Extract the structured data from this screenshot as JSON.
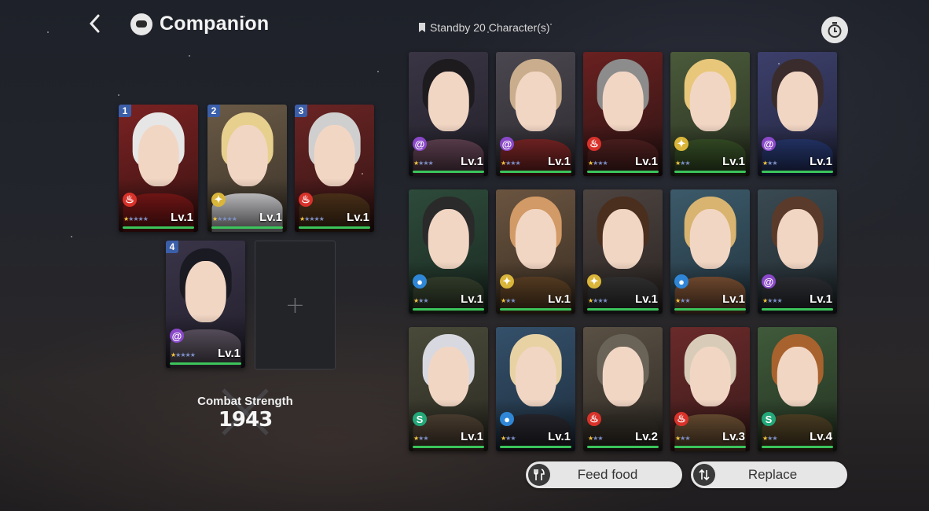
{
  "header": {
    "title": "Companion",
    "standby_label": "Standby 20 Character(s)"
  },
  "colors": {
    "star_on": "#f3c640",
    "star_off": "#7d90c7",
    "level_bar": "#3bc45b",
    "element": {
      "fire": "#d9322a",
      "light": "#d9b53a",
      "arcane": "#8a48c9",
      "water": "#2f86d6",
      "wind": "#23a879"
    }
  },
  "team": [
    {
      "slot": "1",
      "level": "Lv.1",
      "element": "fire",
      "stars": 1,
      "max_stars": 5
    },
    {
      "slot": "2",
      "level": "Lv.1",
      "element": "light",
      "stars": 1,
      "max_stars": 5
    },
    {
      "slot": "3",
      "level": "Lv.1",
      "element": "fire",
      "stars": 1,
      "max_stars": 5
    },
    {
      "slot": "4",
      "level": "Lv.1",
      "element": "arcane",
      "stars": 1,
      "max_stars": 5
    }
  ],
  "empty_slot_icon": "+",
  "combat": {
    "label": "Combat Strength",
    "value": "1943"
  },
  "standby": [
    {
      "level": "Lv.1",
      "element": "arcane",
      "stars": 1,
      "max_stars": 4
    },
    {
      "level": "Lv.1",
      "element": "arcane",
      "stars": 1,
      "max_stars": 4
    },
    {
      "level": "Lv.1",
      "element": "fire",
      "stars": 1,
      "max_stars": 4
    },
    {
      "level": "Lv.1",
      "element": "light",
      "stars": 1,
      "max_stars": 3
    },
    {
      "level": "Lv.1",
      "element": "arcane",
      "stars": 1,
      "max_stars": 3
    },
    {
      "level": "Lv.1",
      "element": "water",
      "stars": 1,
      "max_stars": 3
    },
    {
      "level": "Lv.1",
      "element": "light",
      "stars": 1,
      "max_stars": 3
    },
    {
      "level": "Lv.1",
      "element": "light",
      "stars": 1,
      "max_stars": 4
    },
    {
      "level": "Lv.1",
      "element": "water",
      "stars": 1,
      "max_stars": 3
    },
    {
      "level": "Lv.1",
      "element": "arcane",
      "stars": 1,
      "max_stars": 4
    },
    {
      "level": "Lv.1",
      "element": "wind",
      "stars": 1,
      "max_stars": 3
    },
    {
      "level": "Lv.1",
      "element": "water",
      "stars": 1,
      "max_stars": 3
    },
    {
      "level": "Lv.2",
      "element": "fire",
      "stars": 1,
      "max_stars": 3
    },
    {
      "level": "Lv.3",
      "element": "fire",
      "stars": 1,
      "max_stars": 3
    },
    {
      "level": "Lv.4",
      "element": "wind",
      "stars": 1,
      "max_stars": 3
    }
  ],
  "actions": {
    "feed_label": "Feed food",
    "replace_label": "Replace"
  }
}
